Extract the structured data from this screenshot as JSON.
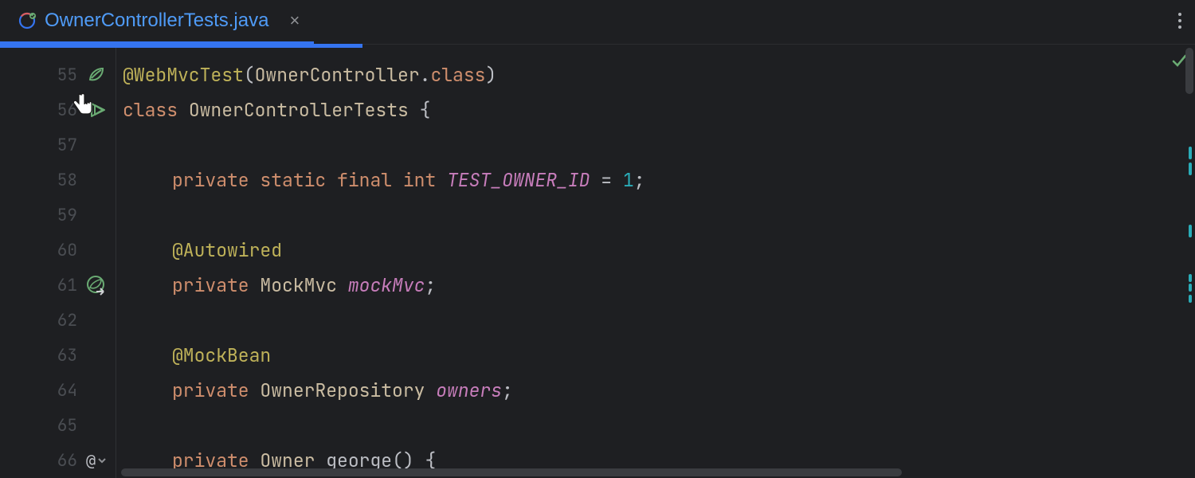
{
  "tab": {
    "filename": "OwnerControllerTests.java",
    "close_glyph": "×"
  },
  "gutter": {
    "lines": [
      "55",
      "56",
      "57",
      "58",
      "59",
      "60",
      "61",
      "62",
      "63",
      "64",
      "65",
      "66"
    ]
  },
  "code": {
    "l55": {
      "annotation": "@WebMvcTest",
      "open": "(",
      "arg": "OwnerController",
      "dot": ".",
      "class_kw": "class",
      "close": ")"
    },
    "l56": {
      "keyword": "class",
      "name": "OwnerControllerTests",
      "brace": " {"
    },
    "l58": {
      "private": "private",
      "static": "static",
      "final": "final",
      "type": "int",
      "field": "TEST_OWNER_ID",
      "eq": " = ",
      "val": "1",
      "semi": ";"
    },
    "l60": {
      "annotation": "@Autowired"
    },
    "l61": {
      "private": "private",
      "type": "MockMvc",
      "field": "mockMvc",
      "semi": ";"
    },
    "l63": {
      "annotation": "@MockBean"
    },
    "l64": {
      "private": "private",
      "type": "OwnerRepository",
      "field": "owners",
      "semi": ";"
    },
    "l66": {
      "private": "private",
      "type": "Owner",
      "method": "george",
      "rest": "() {"
    },
    "at_glyph": "@"
  }
}
